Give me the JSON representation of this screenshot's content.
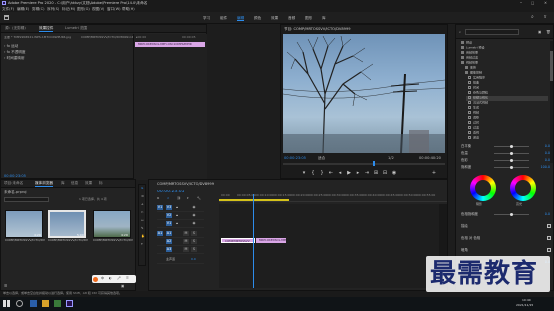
{
  "titlebar": {
    "title": "Adobe Premiere Pro 2020 - C:\\用户\\hkkzy\\文档\\Adobe\\Premiere Pro\\14.0\\未命名"
  },
  "menubar": {
    "items": [
      "文件(F)",
      "编辑(E)",
      "剪辑(C)",
      "序列(S)",
      "标记(M)",
      "图形(G)",
      "视图(V)",
      "窗口(W)",
      "帮助(H)"
    ]
  },
  "workspaces": {
    "items": [
      "学习",
      "组件",
      "编辑",
      "颜色",
      "效果",
      "音频",
      "图形",
      "库"
    ],
    "active": "编辑"
  },
  "source_panel": {
    "tabs": [
      "源：(无剪辑)",
      "效果控件",
      "Lumetri 范围"
    ],
    "clip_label": "主要 * 7MP22K6521.WPS-1M7CO4WPUK6.jpg",
    "seq_label": "COMP/MRTOSSVV/ICTO/DV8999.C4.L",
    "rows": [
      "运动",
      "不透明度",
      "时间重映射"
    ],
    "timecode": "00:00:23:05",
    "clip_name": "MRP1OKEDSOL-MPH-OSC1OMPSZMHR"
  },
  "program_panel": {
    "title": "节目: COMP/MRTOSSVV/ICTO/DV8999",
    "timecode": "00:00:23:05",
    "fit": "适合",
    "ratio": "1/2",
    "duration": "00:00:40:20"
  },
  "project_panel": {
    "tabs": [
      "项目:未命名",
      "媒体浏览器",
      "库",
      "信息",
      "效果",
      "标"
    ],
    "project_name": "未命名.prproj",
    "filter_text": "1 项已选择，共 4 项",
    "thumbs": [
      {
        "label": "COMP/MRTOSSVV/ICTO/DV8999",
        "duration": "4:29"
      },
      {
        "label": "COMP/MRTOSSVV/ICTO/DV8999",
        "duration": "5:00"
      },
      {
        "label": "COMP/MRTOSSVV/ICTO/DV8999",
        "duration": "4:29"
      }
    ]
  },
  "timeline": {
    "seq_name": "COMP/MRTOSSVV/ICTO/DV8999",
    "timecode": "00:00:23:05",
    "ruler": [
      "00:00",
      "00:00:05:00",
      "00:00:10:00",
      "00:00:15:00",
      "00:00:20:00",
      "00:00:25:00",
      "00:00:30:00",
      "00:00:35:00",
      "00:00:40:00",
      "00:00:45:00",
      "00:00:50:00",
      "00:00:55:00",
      "00:01:00:00",
      "00:01:05:00"
    ],
    "video_tracks": [
      "V3",
      "V2",
      "V1"
    ],
    "audio_tracks": [
      "A1",
      "A2",
      "A3"
    ],
    "master": "主声道",
    "master_value": "0.0",
    "clip1": "COMP/MRTOSSVV",
    "clip2": "MRP1OKEDSOL-MPH"
  },
  "effects_panel": {
    "tree": [
      {
        "label": "预设",
        "type": "folder"
      },
      {
        "label": "Lumetri 预设",
        "type": "folder"
      },
      {
        "label": "音频效果",
        "type": "folder"
      },
      {
        "label": "音频过渡",
        "type": "folder"
      },
      {
        "label": "视频效果",
        "type": "folder"
      },
      {
        "label": "变换",
        "type": "folder"
      },
      {
        "label": "图像控制",
        "type": "folder"
      },
      {
        "label": "实用程序",
        "type": "fx"
      },
      {
        "label": "扭曲",
        "type": "fx"
      },
      {
        "label": "时间",
        "type": "fx"
      },
      {
        "label": "杂色与颗粒",
        "type": "fx"
      },
      {
        "label": "模糊与锐化",
        "type": "fx"
      },
      {
        "label": "沉浸式视频",
        "type": "fx"
      },
      {
        "label": "生成",
        "type": "fx"
      },
      {
        "label": "视频",
        "type": "fx"
      },
      {
        "label": "调整",
        "type": "fx"
      },
      {
        "label": "过时",
        "type": "fx"
      },
      {
        "label": "过渡",
        "type": "fx"
      },
      {
        "label": "透视",
        "type": "fx"
      },
      {
        "label": "通道",
        "type": "fx"
      }
    ],
    "selected_index": 11,
    "controls": [
      {
        "label": "白平衡",
        "value": "0.0"
      },
      {
        "label": "色温",
        "value": "0.0"
      },
      {
        "label": "色彩",
        "value": "0.0"
      },
      {
        "label": "饱和度",
        "value": "100.0"
      }
    ],
    "wheel_labels": [
      "阴影",
      "高光"
    ],
    "lower_controls": [
      {
        "label": "色相饱和度",
        "value": "0.0"
      },
      {
        "label": "描绘",
        "checked": true
      },
      {
        "label": "色相 对 色相",
        "checked": true
      },
      {
        "label": "暗角",
        "checked": true
      },
      {
        "label": "数量",
        "value": "0.0"
      }
    ]
  },
  "status": {
    "text": "单击以选择，或单击空白处并拖动以进行选择。使用 Shift、Alt 和 Ctrl 可获得其他选项。"
  },
  "watermark": {
    "text": "最需教育"
  },
  "taskbar": {
    "time": "10:40",
    "date": "2021/11/15"
  },
  "colors": {
    "accent": "#2d8ceb",
    "clip": "#d9a6e6",
    "playhead": "#2d8ceb"
  }
}
